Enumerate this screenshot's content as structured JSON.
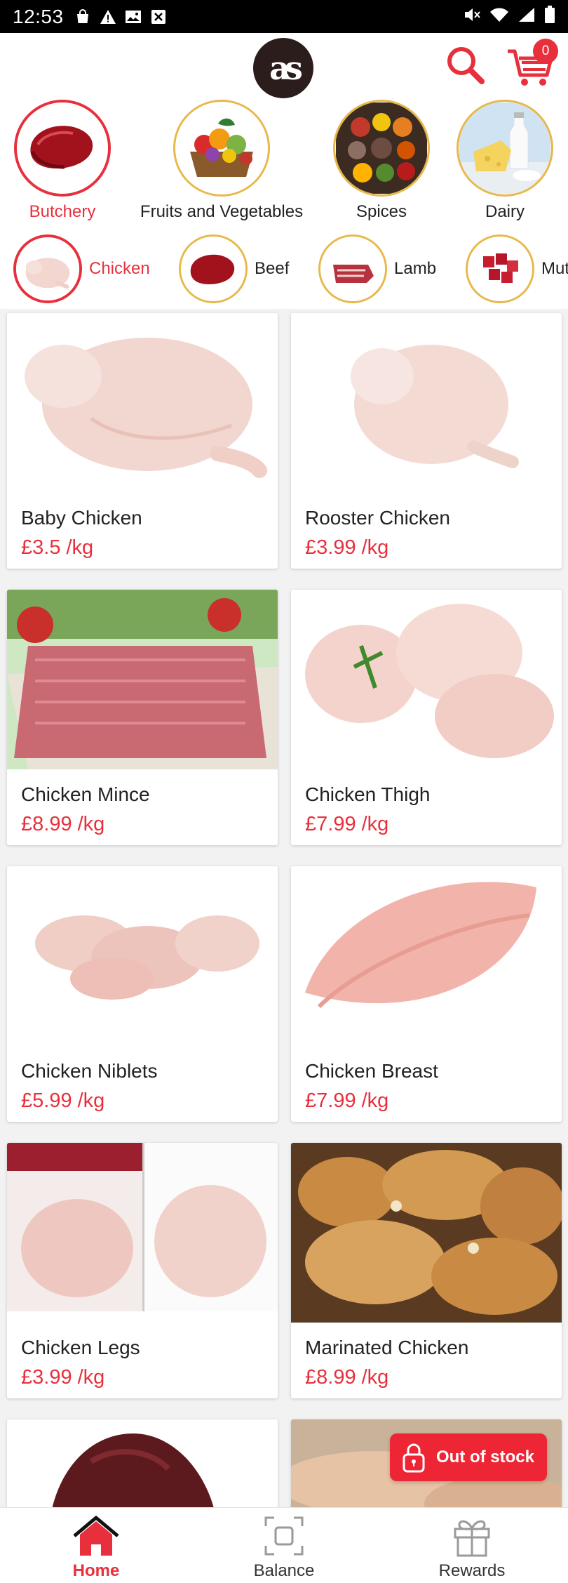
{
  "status_bar": {
    "time": "12:53",
    "left_icons": [
      "bag-icon",
      "warning-icon",
      "image-icon",
      "close-box-icon"
    ],
    "right_icons": [
      "mute-icon",
      "wifi-icon",
      "signal-icon",
      "battery-icon"
    ]
  },
  "header": {
    "logo_text": "as",
    "cart_count": "0"
  },
  "categories": [
    {
      "label": "Butchery",
      "active": true
    },
    {
      "label": "Fruits and Vegetables",
      "active": false
    },
    {
      "label": "Spices",
      "active": false
    },
    {
      "label": "Dairy",
      "active": false
    }
  ],
  "subcategories": [
    {
      "label": "Chicken",
      "active": true
    },
    {
      "label": "Beef",
      "active": false
    },
    {
      "label": "Lamb",
      "active": false
    },
    {
      "label": "Mut",
      "active": false
    }
  ],
  "products": [
    {
      "name": "Baby Chicken",
      "price": "£3.5 /kg"
    },
    {
      "name": "Rooster Chicken",
      "price": "£3.99 /kg"
    },
    {
      "name": "Chicken Mince",
      "price": "£8.99 /kg"
    },
    {
      "name": "Chicken Thigh",
      "price": "£7.99 /kg"
    },
    {
      "name": "Chicken Niblets",
      "price": "£5.99 /kg"
    },
    {
      "name": "Chicken Breast",
      "price": "£7.99 /kg"
    },
    {
      "name": "Chicken Legs",
      "price": "£3.99 /kg"
    },
    {
      "name": "Marinated Chicken",
      "price": "£8.99 /kg"
    }
  ],
  "out_of_stock_label": "Out of stock",
  "bottom_nav": [
    {
      "label": "Home",
      "icon": "home-icon",
      "active": true
    },
    {
      "label": "Balance",
      "icon": "balance-icon",
      "active": false
    },
    {
      "label": "Rewards",
      "icon": "gift-icon",
      "active": false
    }
  ],
  "colors": {
    "accent": "#e8303d",
    "ring": "#e8b84a",
    "logo_bg": "#2a1d1b"
  }
}
